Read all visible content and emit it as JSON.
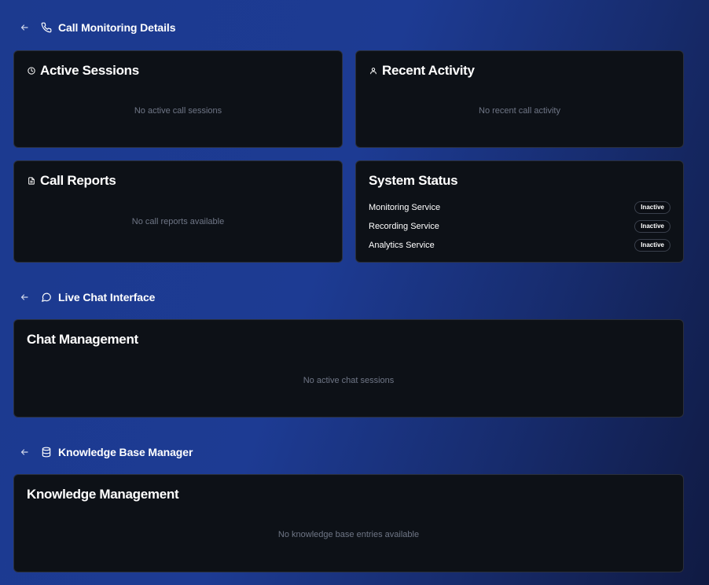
{
  "call_monitoring": {
    "title": "Call Monitoring Details",
    "back_icon": "arrow-left-icon",
    "icon": "phone-icon",
    "active_sessions": {
      "title": "Active Sessions",
      "icon": "clock-icon",
      "empty": "No active call sessions"
    },
    "recent_activity": {
      "title": "Recent Activity",
      "icon": "user-icon",
      "empty": "No recent call activity"
    },
    "call_reports": {
      "title": "Call Reports",
      "icon": "file-text-icon",
      "empty": "No call reports available"
    },
    "system_status": {
      "title": "System Status",
      "services": [
        {
          "name": "Monitoring Service",
          "status": "Inactive"
        },
        {
          "name": "Recording Service",
          "status": "Inactive"
        },
        {
          "name": "Analytics Service",
          "status": "Inactive"
        }
      ]
    }
  },
  "live_chat": {
    "title": "Live Chat Interface",
    "back_icon": "arrow-left-icon",
    "icon": "message-circle-icon",
    "chat_management": {
      "title": "Chat Management",
      "empty": "No active chat sessions"
    }
  },
  "knowledge_base": {
    "title": "Knowledge Base Manager",
    "back_icon": "arrow-left-icon",
    "icon": "database-icon",
    "knowledge_management": {
      "title": "Knowledge Management",
      "empty": "No knowledge base entries available"
    }
  }
}
